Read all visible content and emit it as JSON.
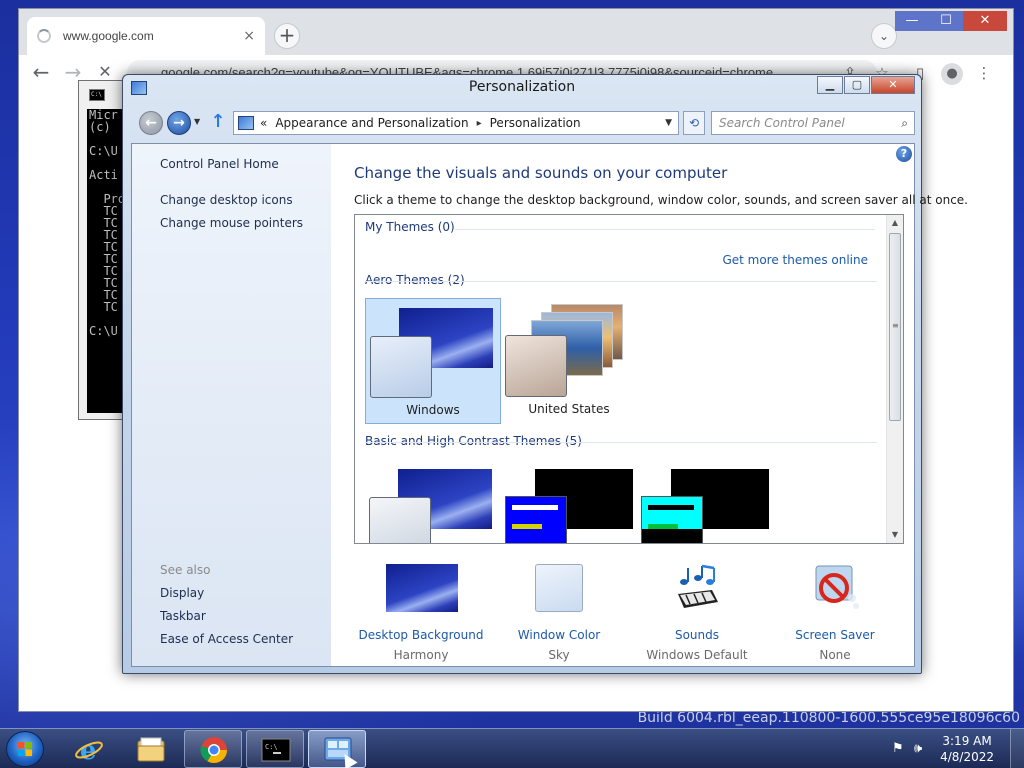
{
  "desktop": {
    "build_text": "Build 6004.rbl_eeap.110800-1600.555ce95e18096c60"
  },
  "browser": {
    "tab_title": "www.google.com",
    "tab_close": "×",
    "new_tab": "+",
    "tab_search": "⌄",
    "url": "google.com/search?q=youtube&oq=YOUTUBE&aqs=chrome.1.69i57j0i271l3.7775j0j98&sourceid=chrome",
    "back": "←",
    "forward": "→",
    "stop": "✕",
    "window_min": "—",
    "window_max": "☐",
    "window_close": "✕",
    "menu": "⋮"
  },
  "cmd": {
    "lines": "Micr\n(c) \n\nC:\\U\n\nActi\n\n  Pro\n  TC\n  TC\n  TC\n  TC\n  TC\n  TC\n  TC\n  TC\n  TC\n\nC:\\U"
  },
  "personalization": {
    "title": "Personalization",
    "nav": {
      "breadcrumb_prefix": "«",
      "crumb_1": "Appearance and Personalization",
      "crumb_sep": "▸",
      "crumb_2": "Personalization",
      "search_placeholder": "Search Control Panel",
      "back": "←",
      "forward": "→",
      "up": "↑",
      "refresh": "⟲"
    },
    "left_pane": {
      "home": "Control Panel Home",
      "desktop_icons": "Change desktop icons",
      "mouse_pointers": "Change mouse pointers",
      "see_also": "See also",
      "display": "Display",
      "taskbar": "Taskbar",
      "ease_of_access": "Ease of Access Center"
    },
    "heading": "Change the visuals and sounds on your computer",
    "description": "Click a theme to change the desktop background, window color, sounds, and screen saver all at once.",
    "groups": {
      "my_themes": "My Themes (0)",
      "get_more": "Get more themes online",
      "aero_themes": "Aero Themes (2)",
      "basic_themes": "Basic and High Contrast Themes (5)"
    },
    "aero": [
      {
        "name": "Windows"
      },
      {
        "name": "United States"
      }
    ],
    "bottom": [
      {
        "link": "Desktop Background",
        "value": "Harmony"
      },
      {
        "link": "Window Color",
        "value": "Sky"
      },
      {
        "link": "Sounds",
        "value": "Windows Default"
      },
      {
        "link": "Screen Saver",
        "value": "None"
      }
    ]
  },
  "taskbar": {
    "time": "3:19 AM",
    "date": "4/8/2022"
  },
  "colors": {
    "link_blue": "#1c5aa8",
    "heading_blue": "#1e3a7a",
    "selection": "#cce4fb"
  }
}
